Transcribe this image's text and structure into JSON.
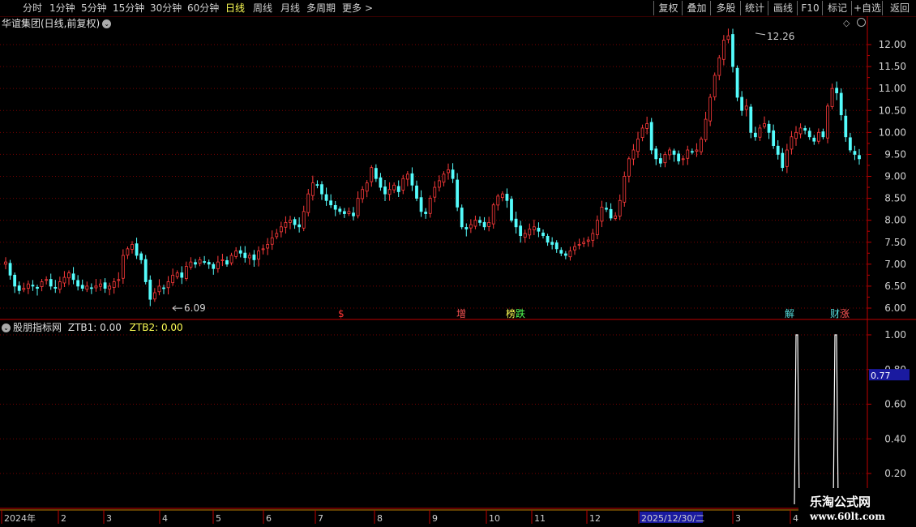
{
  "toolbar": {
    "periods": [
      "分时",
      "1分钟",
      "5分钟",
      "15分钟",
      "30分钟",
      "60分钟",
      "日线",
      "周线",
      "月线",
      "多周期",
      "更多"
    ],
    "active_period": "日线",
    "more_arrow": ">",
    "right_buttons": [
      "复权",
      "叠加",
      "多股",
      "统计",
      "画线",
      "F10",
      "标记",
      "+自选",
      "返回"
    ]
  },
  "stock": {
    "title": "华谊集团(日线,前复权)",
    "high_marker": "12.26",
    "low_marker": "6.09"
  },
  "indicator": {
    "name": "股朋指标网",
    "ztb1_label": "ZTB1: 0.00",
    "ztb2_label": "ZTB2: 0.00",
    "current_value": "0.77"
  },
  "events": [
    {
      "label": "$",
      "color": "#ff3333"
    },
    {
      "label": "增",
      "color": "#ff5555"
    },
    {
      "label": "榜",
      "color": "#ffff55"
    },
    {
      "label": "跌",
      "color": "#55ff55"
    },
    {
      "label": "解",
      "color": "#55dddd"
    },
    {
      "label": "财",
      "color": "#55dddd"
    },
    {
      "label": "涨",
      "color": "#ff5555"
    }
  ],
  "time_axis": {
    "labels": [
      "2024年",
      "2",
      "3",
      "4",
      "5",
      "6",
      "7",
      "8",
      "9",
      "10",
      "11",
      "12",
      "2025/12/30/二",
      "3",
      "4"
    ]
  },
  "watermark": {
    "title": "乐淘公式网",
    "url": "www.60lt.com"
  },
  "colors": {
    "up": "#ff3b3b",
    "down": "#54fcfc",
    "grid": "#7a0000",
    "axis": "#c00000",
    "ztb2": "#ffff55"
  },
  "chart_data": [
    {
      "type": "candlestick",
      "title": "华谊集团(日线,前复权)",
      "y_ticks": [
        6.0,
        6.5,
        7.0,
        7.5,
        8.0,
        8.5,
        9.0,
        9.5,
        10.0,
        10.5,
        11.0,
        11.5,
        12.0
      ],
      "ylim": [
        5.8,
        12.6
      ],
      "annotations": [
        {
          "label": "12.26",
          "value": 12.26
        },
        {
          "label": "6.09",
          "value": 6.09
        }
      ],
      "close_series": [
        7.05,
        6.75,
        6.5,
        6.4,
        6.45,
        6.55,
        6.5,
        6.45,
        6.6,
        6.65,
        6.5,
        6.45,
        6.6,
        6.7,
        6.8,
        6.65,
        6.5,
        6.45,
        6.5,
        6.45,
        6.5,
        6.55,
        6.45,
        6.5,
        6.6,
        6.65,
        7.2,
        7.35,
        7.45,
        7.2,
        7.1,
        6.6,
        6.2,
        6.35,
        6.5,
        6.45,
        6.6,
        6.75,
        6.8,
        6.7,
        6.95,
        7.05,
        7.0,
        7.1,
        7.05,
        7.0,
        6.9,
        7.05,
        7.1,
        7.0,
        7.2,
        7.3,
        7.25,
        7.15,
        7.2,
        7.1,
        7.3,
        7.35,
        7.45,
        7.6,
        7.7,
        7.85,
        7.95,
        8.0,
        7.9,
        7.85,
        8.2,
        8.6,
        8.85,
        8.8,
        8.6,
        8.45,
        8.35,
        8.25,
        8.2,
        8.15,
        8.2,
        8.1,
        8.5,
        8.7,
        8.85,
        9.2,
        8.95,
        8.75,
        8.6,
        8.7,
        8.8,
        8.65,
        8.95,
        9.05,
        8.8,
        8.5,
        8.2,
        8.15,
        8.5,
        8.75,
        8.9,
        9.05,
        9.15,
        8.95,
        8.3,
        7.85,
        7.8,
        7.9,
        8.0,
        7.95,
        7.85,
        7.95,
        8.35,
        8.55,
        8.6,
        8.45,
        8.0,
        7.85,
        7.65,
        7.7,
        7.8,
        7.85,
        7.75,
        7.65,
        7.5,
        7.45,
        7.35,
        7.25,
        7.2,
        7.3,
        7.4,
        7.45,
        7.5,
        7.55,
        7.7,
        8.0,
        8.3,
        8.25,
        8.05,
        8.1,
        8.45,
        9.0,
        9.4,
        9.6,
        9.85,
        10.1,
        10.2,
        9.6,
        9.4,
        9.3,
        9.5,
        9.6,
        9.5,
        9.35,
        9.4,
        9.6,
        9.55,
        9.6,
        9.85,
        10.3,
        10.8,
        11.3,
        11.7,
        12.1,
        12.2,
        11.5,
        10.8,
        10.5,
        10.6,
        10.0,
        9.9,
        10.1,
        10.2,
        10.0,
        9.7,
        9.5,
        9.2,
        9.6,
        9.9,
        10.0,
        10.1,
        10.05,
        9.9,
        9.8,
        10.0,
        9.9,
        10.6,
        11.0,
        10.9,
        10.4,
        9.9,
        9.6,
        9.5,
        9.4
      ]
    },
    {
      "type": "bar",
      "title": "股朋指标网",
      "y_ticks": [
        0.2,
        0.4,
        0.6,
        0.8,
        1.0
      ],
      "series": [
        {
          "name": "ZTB1",
          "values": [
            1.0,
            1.0
          ]
        },
        {
          "name": "ZTB2",
          "values": [
            0.0,
            0.0
          ]
        }
      ]
    }
  ]
}
